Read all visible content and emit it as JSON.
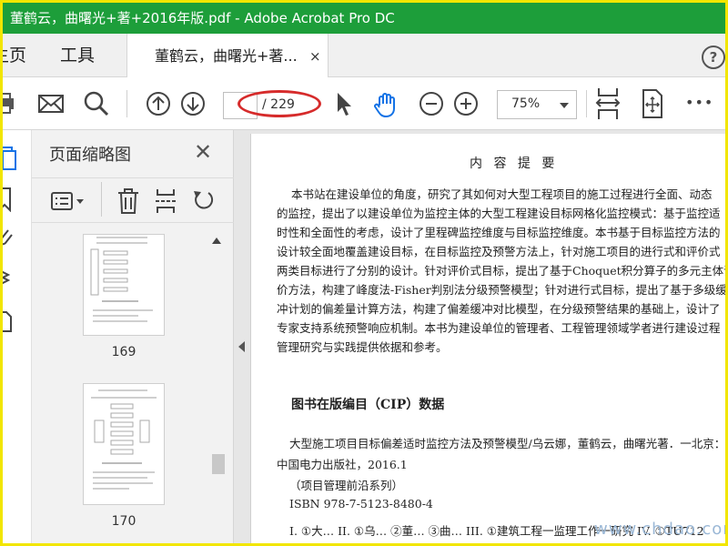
{
  "window": {
    "title": "董鹤云，曲曙光+著+2016年版.pdf - Adobe Acrobat Pro DC"
  },
  "tabs": {
    "home": "主页",
    "tools": "工具",
    "document": "董鹤云，曲曙光+著...",
    "close": "×",
    "help": "?"
  },
  "toolbar": {
    "page_current": "",
    "page_total": "/ 229",
    "zoom": "75%",
    "more": "•••"
  },
  "panel": {
    "title": "页面缩略图",
    "close": "✕",
    "thumbnails": [
      {
        "page": "169"
      },
      {
        "page": "170"
      }
    ]
  },
  "document": {
    "heading": "内 容 提 要",
    "paragraph": [
      "本书站在建设单位的角度，研究了其如何对大型工程项目的施工过程进行全面、动态",
      "的监控，提出了以建设单位为监控主体的大型工程建设目标网格化监控模式：基于监控适",
      "时性和全面性的考虑，设计了里程碑监控维度与目标监控维度。本书基于目标监控方法的",
      "设计较全面地覆盖建设目标，在目标监控及预警方法上，针对施工项目的进行式和评价式",
      "两类目标进行了分别的设计。针对评价式目标，提出了基于Choquet积分算子的多元主体评",
      "价方法，构建了峰度法-Fisher判别法分级预警模型；针对进行式目标，提出了基于多级缓",
      "冲计划的偏差量计算方法，构建了偏差缓冲对比模型，在分级预警结果的基础上，设计了",
      "专家支持系统预警响应机制。本书为建设单位的管理者、工程管理领域学者进行建设过程",
      "管理研究与实践提供依据和参考。"
    ],
    "cip_title": "图书在版编目（CIP）数据",
    "cip_lines": [
      "大型施工项目目标偏差适时监控方法及预警模型/乌云娜，董鹤云，曲曙光著．一北京：",
      "中国电力出版社，2016.1",
      "（项目管理前沿系列）",
      "ISBN  978-7-5123-8480-4",
      "I. ①大…  II. ①乌…  ②董…  ③曲…  III. ①建筑工程一监理工作一研究  IV. ①TU712"
    ]
  },
  "watermark": "www.chdao.com",
  "colors": {
    "titlebar": "#1d9e3a",
    "accent": "#1473e6",
    "annotation": "#d62b2b"
  }
}
